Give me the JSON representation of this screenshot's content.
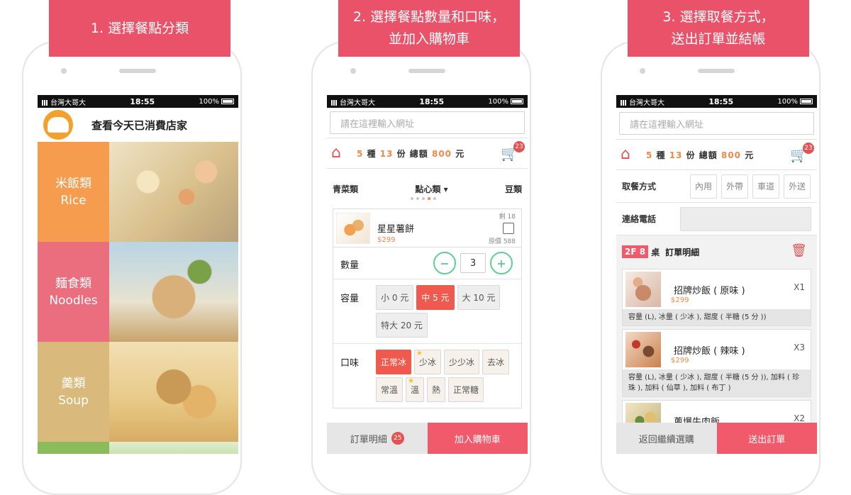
{
  "steps": [
    {
      "line1": "1. 選擇餐點分類",
      "line2": ""
    },
    {
      "line1": "2. 選擇餐點數量和口味，",
      "line2": "並加入購物車"
    },
    {
      "line1": "3. 選擇取餐方式，",
      "line2": "送出訂單並結帳"
    }
  ],
  "statusbar": {
    "carrier": "台灣大哥大",
    "time": "18:55",
    "battery": "100%"
  },
  "screen1": {
    "title": "查看今天已消費店家",
    "categories": [
      {
        "zh": "米飯類",
        "en": "Rice"
      },
      {
        "zh": "麵食類",
        "en": "Noodles"
      },
      {
        "zh": "羹類",
        "en": "Soup"
      }
    ]
  },
  "app": {
    "url_placeholder": "請在這裡輸入網址",
    "summary": {
      "n1": "5",
      "t1": " 種 ",
      "n2": "13",
      "t2": " 份 總額 ",
      "n3": "800",
      "t3": " 元"
    },
    "cart_count": "23"
  },
  "screen2": {
    "tabs": [
      "青菜類",
      "點心類 ▾",
      "豆類"
    ],
    "item": {
      "name": "星星薯餅",
      "price": "$299",
      "left": "剩 18",
      "original": "原價 588"
    },
    "quantity_label": "數量",
    "quantity": "3",
    "minus": "−",
    "plus": "+",
    "size_label": "容量",
    "sizes": [
      "小 0 元",
      "中 5 元",
      "大 10 元",
      "特大 20 元"
    ],
    "flavor_label": "口味",
    "flavors": [
      "正常冰",
      "少冰",
      "少少冰",
      "去冰",
      "常溫",
      "溫",
      "熱",
      "正常糖"
    ],
    "bottom_left": "訂單明細",
    "bottom_badge": "25",
    "bottom_right": "加入購物車"
  },
  "screen3": {
    "pickup_label": "取餐方式",
    "pickup_options": [
      "內用",
      "外帶",
      "車道",
      "外送"
    ],
    "phone_label": "連絡電話",
    "table": "2F 8",
    "table_suffix": "桌",
    "order_title": "訂單明細",
    "orders": [
      {
        "name": "招牌炒飯 ( 原味 )",
        "price": "$299",
        "qty": "X1",
        "detail": "容量 (L), 冰量 ( 少冰 ), 甜度 ( 半糖 (5 分 ))"
      },
      {
        "name": "招牌炒飯 ( 辣味 )",
        "price": "$299",
        "qty": "X3",
        "detail": "容量 (L), 冰量 ( 少冰 ), 甜度 ( 半糖 (5 分 )), 加料 ( 珍珠 ), 加料 ( 仙草 ), 加料 ( 布丁 )"
      },
      {
        "name": "蔥爆牛肉飯",
        "price": "",
        "qty": "X2",
        "detail": ""
      }
    ],
    "bottom_left": "返回繼續選購",
    "bottom_right": "送出訂單"
  }
}
